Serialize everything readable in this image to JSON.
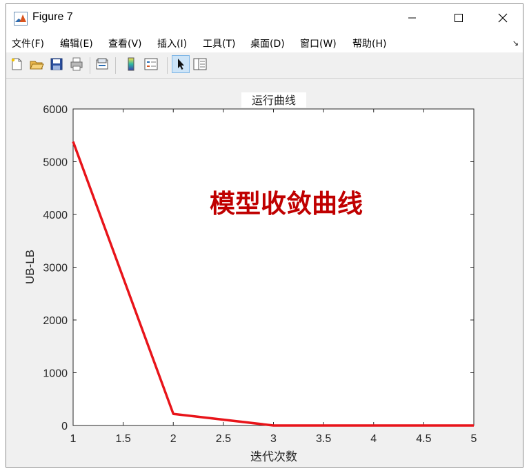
{
  "window": {
    "title": "Figure 7"
  },
  "menu": [
    "文件(F)",
    "编辑(E)",
    "查看(V)",
    "插入(I)",
    "工具(T)",
    "桌面(D)",
    "窗口(W)",
    "帮助(H)"
  ],
  "toolbar_icons": [
    "new-figure-icon",
    "open-file-icon",
    "save-icon",
    "print-icon",
    "link-plot-icon",
    "colorbar-icon",
    "legend-icon",
    "edit-plot-arrow-icon",
    "property-inspector-icon"
  ],
  "colors": {
    "line": "#e8141a",
    "annotation": "#c00000",
    "figure_bg": "#f0f0f0",
    "axes_bg": "#ffffff"
  },
  "chart_data": {
    "type": "line",
    "title": "运行曲线",
    "xlabel": "迭代次数",
    "ylabel": "UB-LB",
    "annotation": "模型收敛曲线",
    "xlim": [
      1,
      5
    ],
    "ylim": [
      0,
      6000
    ],
    "xticks": [
      "1",
      "1.5",
      "2",
      "2.5",
      "3",
      "3.5",
      "4",
      "4.5",
      "5"
    ],
    "yticks": [
      "0",
      "1000",
      "2000",
      "3000",
      "4000",
      "5000",
      "6000"
    ],
    "grid": false,
    "series": [
      {
        "x": [
          1,
          2,
          3,
          4,
          5
        ],
        "y": [
          5380,
          220,
          0,
          0,
          0
        ]
      }
    ]
  }
}
